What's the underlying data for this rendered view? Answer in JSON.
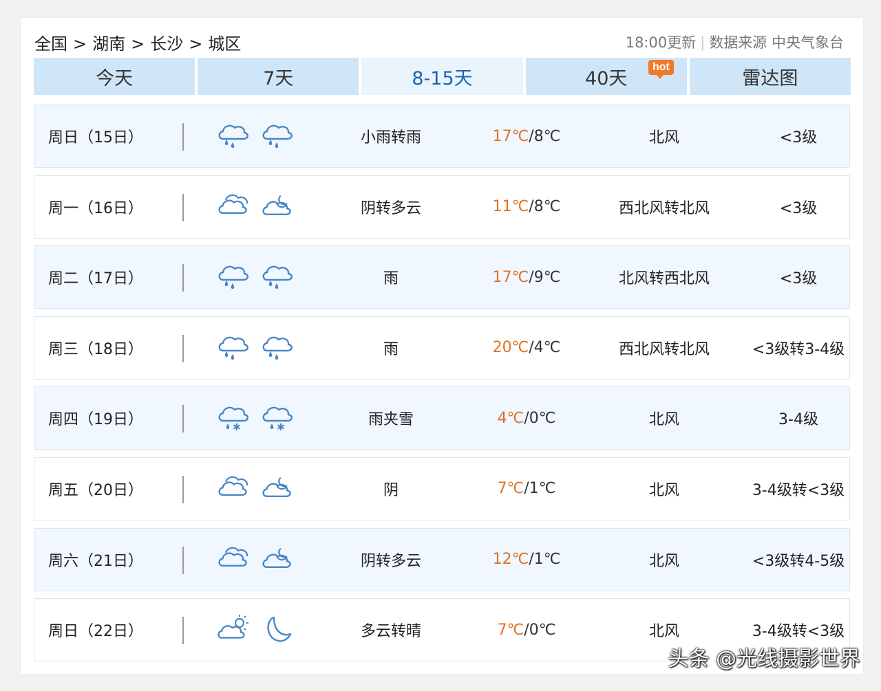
{
  "breadcrumb": {
    "items": [
      "全国",
      "湖南",
      "长沙",
      "城区"
    ],
    "separator": ">"
  },
  "meta": {
    "updated": "18:00更新",
    "divider": "|",
    "source": "数据来源 中央气象台"
  },
  "tabs": [
    {
      "label": "今天",
      "active": false
    },
    {
      "label": "7天",
      "active": false
    },
    {
      "label": "8-15天",
      "active": true
    },
    {
      "label": "40天",
      "active": false
    },
    {
      "label": "雷达图",
      "active": false
    }
  ],
  "hot_badge": "hot",
  "colors": {
    "tab_bg": "#cfe5f8",
    "tab_active_bg": "#eaf4fd",
    "tab_active_text": "#1e63b0",
    "high_temp": "#e07125",
    "icon_blue": "#4a86c5",
    "row_alt_bg": "#f0f7fe"
  },
  "rows": [
    {
      "day": "周日（15日）",
      "icon_day": "rain-icon",
      "icon_night": "rain-icon",
      "desc": "小雨转雨",
      "high": "17℃",
      "low": "8℃",
      "wind": "北风",
      "level": "<3级"
    },
    {
      "day": "周一（16日）",
      "icon_day": "cloudy-icon",
      "icon_night": "partly-cloudy-night-icon",
      "desc": "阴转多云",
      "high": "11℃",
      "low": "8℃",
      "wind": "西北风转北风",
      "level": "<3级"
    },
    {
      "day": "周二（17日）",
      "icon_day": "rain-icon",
      "icon_night": "rain-icon",
      "desc": "雨",
      "high": "17℃",
      "low": "9℃",
      "wind": "北风转西北风",
      "level": "<3级"
    },
    {
      "day": "周三（18日）",
      "icon_day": "rain-icon",
      "icon_night": "rain-icon",
      "desc": "雨",
      "high": "20℃",
      "low": "4℃",
      "wind": "西北风转北风",
      "level": "<3级转3-4级"
    },
    {
      "day": "周四（19日）",
      "icon_day": "sleet-icon",
      "icon_night": "sleet-icon",
      "desc": "雨夹雪",
      "high": "4℃",
      "low": "0℃",
      "wind": "北风",
      "level": "3-4级"
    },
    {
      "day": "周五（20日）",
      "icon_day": "cloudy-icon",
      "icon_night": "partly-cloudy-night-icon",
      "desc": "阴",
      "high": "7℃",
      "low": "1℃",
      "wind": "北风",
      "level": "3-4级转<3级"
    },
    {
      "day": "周六（21日）",
      "icon_day": "cloudy-icon",
      "icon_night": "partly-cloudy-night-icon",
      "desc": "阴转多云",
      "high": "12℃",
      "low": "1℃",
      "wind": "北风",
      "level": "<3级转4-5级"
    },
    {
      "day": "周日（22日）",
      "icon_day": "partly-cloudy-day-icon",
      "icon_night": "moon-icon",
      "desc": "多云转晴",
      "high": "7℃",
      "low": "0℃",
      "wind": "北风",
      "level": "3-4级转<3级"
    }
  ],
  "watermark": "头条 @光线摄影世界"
}
